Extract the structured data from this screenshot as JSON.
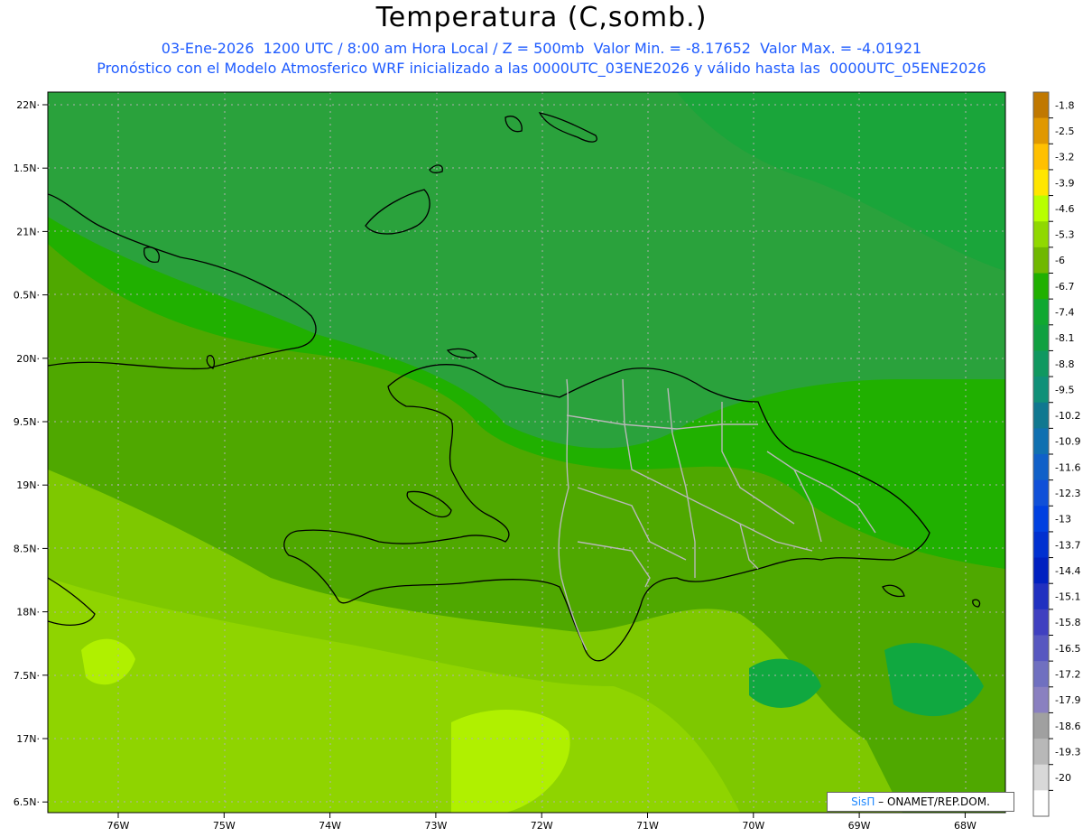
{
  "title": "Temperatura (C,somb.)",
  "subtitle_line1": "03-Ene-2026  1200 UTC / 8:00 am Hora Local / Z = 500mb  Valor Min. = -8.17652  Valor Max. = -4.01921",
  "subtitle_line2": "Pronóstico con el Modelo Atmosferico WRF inicializado a las 0000UTC_03ENE2026 y válido hasta las  0000UTC_05ENE2026",
  "credit": {
    "logo": "SisΠ",
    "text": "– ONAMET/REP.DOM."
  },
  "y_ticks": [
    "22N",
    "1.5N",
    "21N",
    "0.5N",
    "20N",
    "9.5N",
    "19N",
    "8.5N",
    "18N",
    "7.5N",
    "17N",
    "6.5N"
  ],
  "x_ticks": [
    "76W",
    "75W",
    "74W",
    "73W",
    "72W",
    "71W",
    "70W",
    "69W",
    "68W"
  ],
  "colorbar": {
    "labels": [
      "-1.8",
      "-2.5",
      "-3.2",
      "-3.9",
      "-4.6",
      "-5.3",
      "-6",
      "-6.7",
      "-7.4",
      "-8.1",
      "-8.8",
      "-9.5",
      "-10.2",
      "-10.9",
      "-11.6",
      "-12.3",
      "-13",
      "-13.7",
      "-14.4",
      "-15.1",
      "-15.8",
      "-16.5",
      "-17.2",
      "-17.9",
      "-18.6",
      "-19.3",
      "-20"
    ],
    "colors": [
      "#c07800",
      "#e09800",
      "#ffc000",
      "#ffe600",
      "#b8ff00",
      "#90d800",
      "#70b800",
      "#20b000",
      "#10a830",
      "#10a040",
      "#109860",
      "#109078",
      "#107890",
      "#1070b0",
      "#1060c8",
      "#1050d8",
      "#0040e0",
      "#0030d0",
      "#0020c0",
      "#2030c0",
      "#4040c0",
      "#5858c0",
      "#7070c0",
      "#8a80c0",
      "#a0a0a0",
      "#b8b8b8",
      "#d8d8d8",
      "#ffffff"
    ]
  },
  "field_colors": {
    "north_dark": "#1aa53a",
    "mid_green": "#20b000",
    "olive": "#4fa800",
    "light": "#7ec800",
    "lighter": "#8fd400",
    "lime": "#b0f000"
  }
}
